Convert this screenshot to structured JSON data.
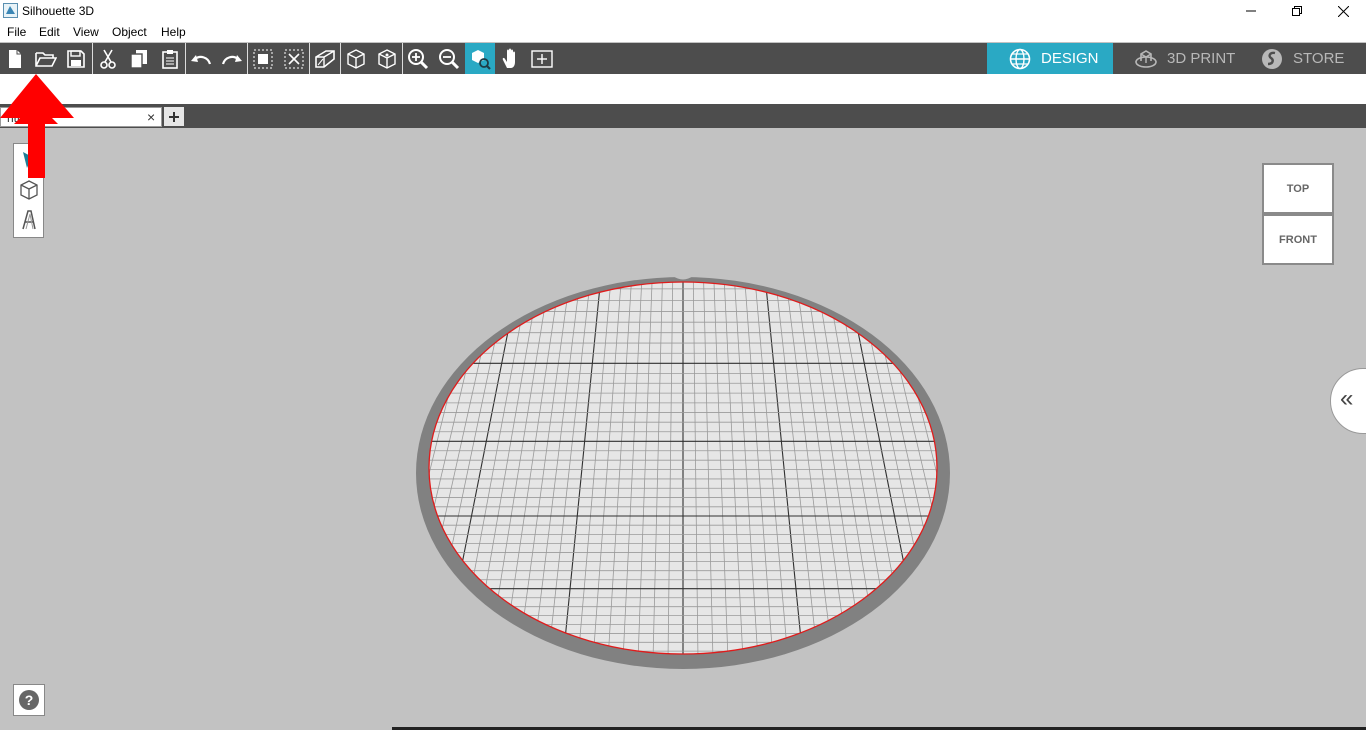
{
  "window": {
    "title": "Silhouette 3D",
    "controls": {
      "minimize": "—",
      "restore": "❐",
      "close": "✕"
    }
  },
  "menu": [
    "File",
    "Edit",
    "View",
    "Object",
    "Help"
  ],
  "toolbar": {
    "tools": [
      "new",
      "open",
      "save",
      "cut",
      "copy",
      "paste",
      "undo",
      "redo",
      "group",
      "ungroup",
      "extrude",
      "view-3d",
      "view-3d-alt",
      "zoom-in",
      "zoom-out",
      "zoom-to-fit",
      "pan",
      "fit-page"
    ],
    "active_tool": "zoom-to-fit",
    "accent_color": "#2aa9c4"
  },
  "modes": {
    "design": "DESIGN",
    "print": "3D PRINT",
    "store": "STORE",
    "active": "design"
  },
  "document_tab": {
    "label": "ntitl   -1",
    "close": "×",
    "new_tab": "+"
  },
  "left_tools": [
    "select-icon",
    "cube-icon",
    "text-icon"
  ],
  "view_cube": {
    "top": "TOP",
    "front": "FRONT"
  },
  "panel_toggle": "«",
  "help": "?",
  "annotation": {
    "color": "#ff0000"
  }
}
